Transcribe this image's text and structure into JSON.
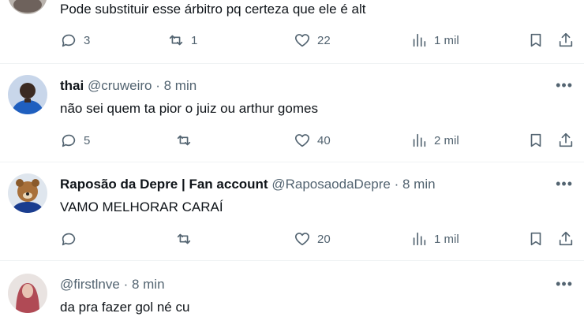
{
  "posts": [
    {
      "name": "",
      "handle": "",
      "time": "",
      "text": "Pode substituir esse árbitro pq certeza que ele é alt",
      "replies": "3",
      "reposts": "1",
      "likes": "22",
      "views": "1 mil"
    },
    {
      "name": "thai",
      "handle": "@cruweiro",
      "time": "8 min",
      "text": "não sei quem ta pior o juiz ou arthur gomes",
      "replies": "5",
      "reposts": "",
      "likes": "40",
      "views": "2 mil"
    },
    {
      "name": "Raposão da Depre | Fan account",
      "handle": "@RaposaodaDepre",
      "time": "8 min",
      "text": "VAMO MELHORAR CARAÍ",
      "replies": "",
      "reposts": "",
      "likes": "20",
      "views": "1 mil"
    },
    {
      "name": "",
      "handle": "@firstlnve",
      "time": "8 min",
      "text": "da pra fazer gol né cu"
    }
  ],
  "separator": "·",
  "more_glyph": "•••",
  "colors": {
    "muted": "#536471",
    "text": "#0f1419",
    "divider": "#eff3f4"
  }
}
